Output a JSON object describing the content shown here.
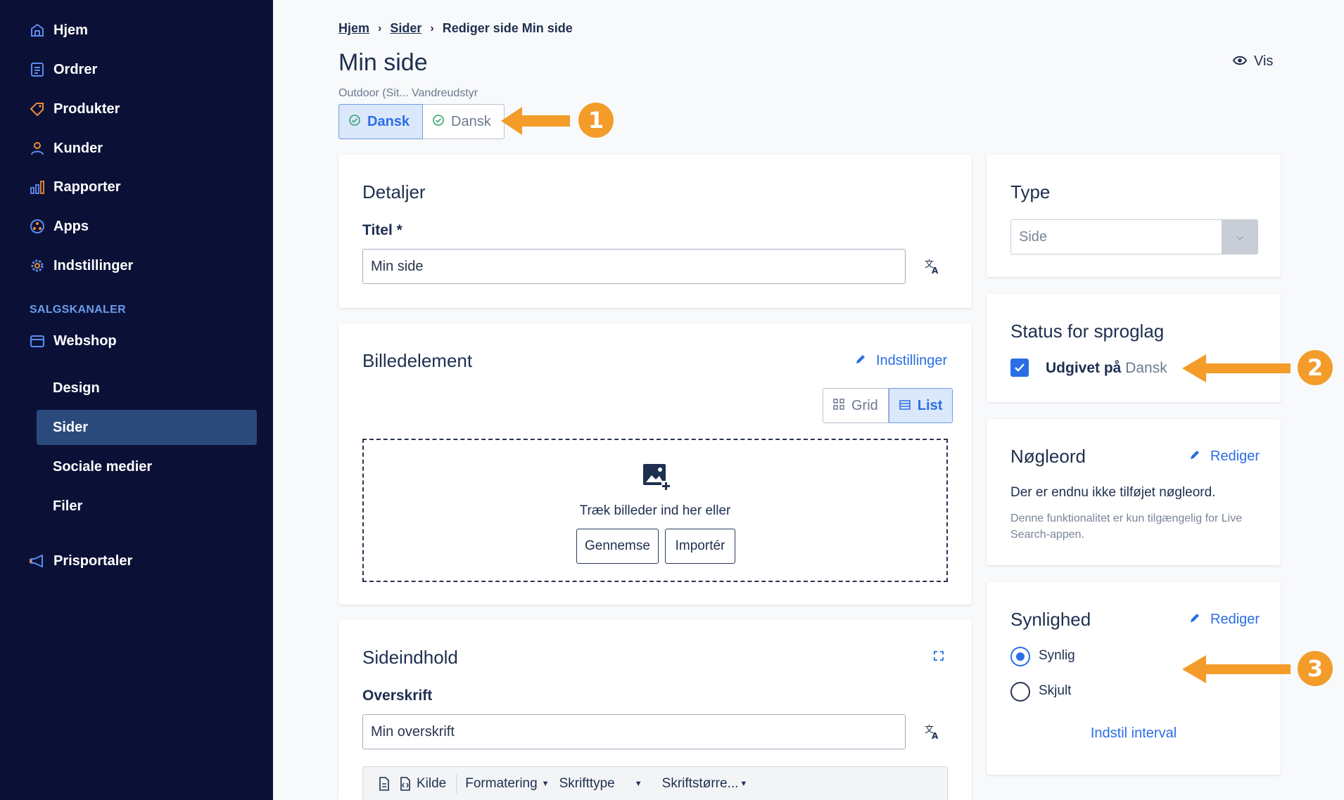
{
  "sidebar": {
    "items": [
      {
        "label": "Hjem"
      },
      {
        "label": "Ordrer"
      },
      {
        "label": "Produkter"
      },
      {
        "label": "Kunder"
      },
      {
        "label": "Rapporter"
      },
      {
        "label": "Apps"
      },
      {
        "label": "Indstillinger"
      }
    ],
    "section_heading": "SALGSKANALER",
    "webshop": {
      "label": "Webshop"
    },
    "webshop_sub": [
      {
        "label": "Design"
      },
      {
        "label": "Sider"
      },
      {
        "label": "Sociale medier"
      },
      {
        "label": "Filer"
      }
    ],
    "prisportaler": {
      "label": "Prisportaler"
    }
  },
  "breadcrumb": {
    "home": "Hjem",
    "pages": "Sider",
    "current": "Rediger side Min side"
  },
  "page": {
    "title": "Min side",
    "view_label": "Vis",
    "store_path": "Outdoor (Sit...  Vandreudstyr",
    "lang_tabs": [
      "Dansk",
      "Dansk"
    ]
  },
  "details": {
    "title": "Detaljer",
    "title_label": "Titel *",
    "title_value": "Min side"
  },
  "image_element": {
    "title": "Billedelement",
    "settings_label": "Indstillinger",
    "view_grid": "Grid",
    "view_list": "List",
    "drop_text": "Træk billeder ind her eller",
    "browse_label": "Gennemse",
    "import_label": "Importér"
  },
  "content": {
    "title": "Sideindhold",
    "heading_label": "Overskrift",
    "heading_value": "Min overskrift",
    "toolbar": {
      "source": "Kilde",
      "format": "Formatering",
      "font": "Skrifttype",
      "size": "Skriftstørre..."
    }
  },
  "type_card": {
    "title": "Type",
    "value": "Side"
  },
  "lang_status": {
    "title": "Status for sproglag",
    "published_prefix": "Udgivet på",
    "language": "Dansk"
  },
  "keywords": {
    "title": "Nøgleord",
    "edit_label": "Rediger",
    "empty_text": "Der er endnu ikke tilføjet nøgleord.",
    "note": "Denne funktionalitet er kun tilgængelig for Live Search-appen."
  },
  "visibility": {
    "title": "Synlighed",
    "edit_label": "Rediger",
    "visible": "Synlig",
    "hidden": "Skjult",
    "interval_label": "Indstil interval"
  },
  "callouts": [
    "1",
    "2",
    "3"
  ],
  "colors": {
    "sidebar_bg": "#0b1136",
    "accent": "#2a6ee6",
    "callout": "#f39c2a",
    "active_nav": "#2b4a7c"
  }
}
